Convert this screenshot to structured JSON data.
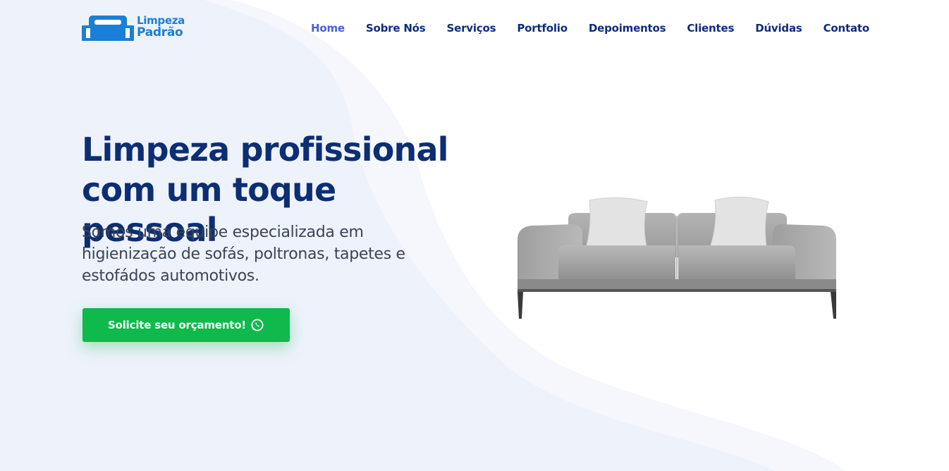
{
  "brand": {
    "name_line1": "Limpeza",
    "name_line2": "Padrão",
    "logo_icon": "sofa-logo-icon",
    "color": "#1a7fd6"
  },
  "nav": {
    "items": [
      {
        "label": "Home",
        "active": true
      },
      {
        "label": "Sobre Nós",
        "active": false
      },
      {
        "label": "Serviços",
        "active": false
      },
      {
        "label": "Portfolio",
        "active": false
      },
      {
        "label": "Depoimentos",
        "active": false
      },
      {
        "label": "Clientes",
        "active": false
      },
      {
        "label": "Dúvidas",
        "active": false
      },
      {
        "label": "Contato",
        "active": false
      }
    ]
  },
  "hero": {
    "title": "Limpeza profissional com um toque pessoal",
    "subtitle": "Somos uma equipe especializada em higienização de sofás, poltronas, tapetes e estofádos automotivos.",
    "cta_label": "Solicite seu orçamento!",
    "cta_icon": "whatsapp-icon",
    "image": "sofa-image"
  },
  "colors": {
    "primary_text": "#0c2e72",
    "nav_active": "#4661d6",
    "cta": "#0fb94c",
    "background_wave": "#eef2fb"
  }
}
